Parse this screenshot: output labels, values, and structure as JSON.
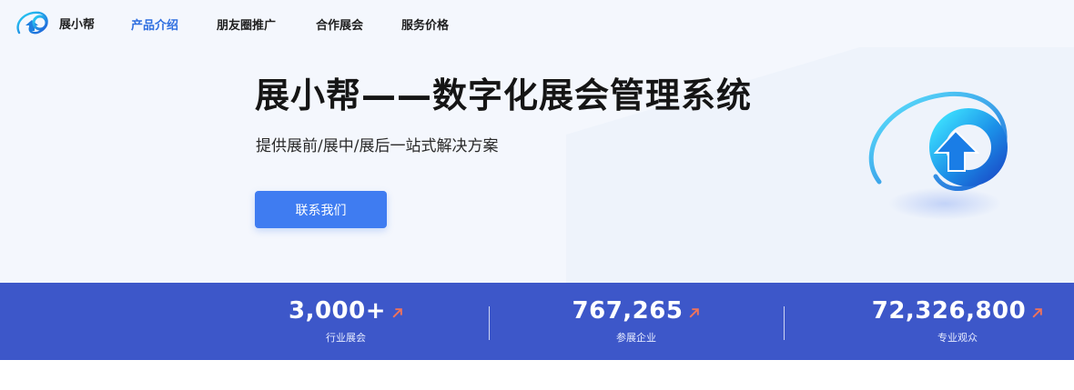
{
  "brand": {
    "name": "展小帮"
  },
  "nav": {
    "items": [
      {
        "label": "产品介绍",
        "active": true
      },
      {
        "label": "朋友圈推广",
        "active": false
      },
      {
        "label": "合作展会",
        "active": false
      },
      {
        "label": "服务价格",
        "active": false
      }
    ]
  },
  "hero": {
    "title": "展小帮——数字化展会管理系统",
    "subtitle": "提供展前/展中/展后一站式解决方案",
    "cta_label": "联系我们"
  },
  "stats": [
    {
      "value": "3,000+",
      "label": "行业展会",
      "icon": "arrow-up-right-icon"
    },
    {
      "value": "767,265",
      "label": "参展企业",
      "icon": "arrow-up-right-icon"
    },
    {
      "value": "72,326,800",
      "label": "专业观众",
      "icon": "arrow-up-right-icon"
    }
  ],
  "colors": {
    "accent": "#2f6fe0",
    "button": "#3f7cf1",
    "stats_band": "#3d57c9",
    "arrow": "#f0735a"
  }
}
